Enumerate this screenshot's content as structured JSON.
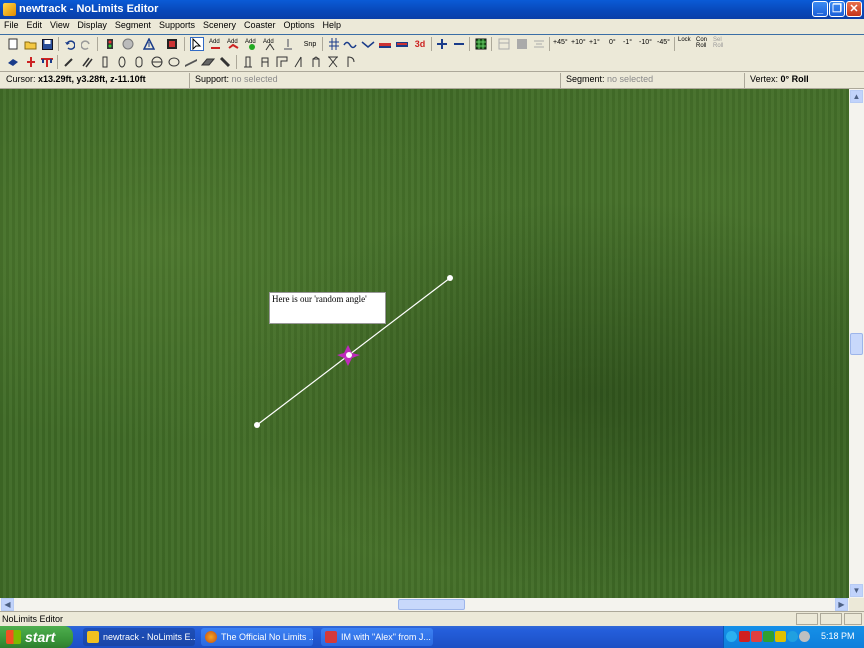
{
  "window": {
    "title": "newtrack - NoLimits Editor"
  },
  "menu": [
    "File",
    "Edit",
    "View",
    "Display",
    "Segment",
    "Supports",
    "Scenery",
    "Coaster",
    "Options",
    "Help"
  ],
  "toolbar1": {
    "add_labels": [
      "Add",
      "Add",
      "Add",
      "Add"
    ],
    "snap_label": "Snp",
    "threed_label": "3d",
    "roll_labels": [
      "+45°",
      "+10°",
      "+1°",
      "0°",
      "-1°",
      "-10°",
      "-45°"
    ],
    "lock_label": "Lock",
    "con_roll_label": "Con Roll",
    "sel_roll_label": "Sel Roll"
  },
  "status": {
    "cursor_label": "Cursor:",
    "cursor_value": "x13.29ft, y3.28ft, z-11.10ft",
    "support_label": "Support:",
    "support_value": "no selected",
    "segment_label": "Segment:",
    "segment_value": "no selected",
    "vertex_label": "Vertex:",
    "vertex_value": "0° Roll"
  },
  "annotation": {
    "text": "Here is our 'random angle'"
  },
  "statusbar": {
    "text": "NoLimits Editor"
  },
  "taskbar": {
    "start_label": "start",
    "tasks": [
      {
        "label": "newtrack - NoLimits E..."
      },
      {
        "label": "The Official No Limits ..."
      },
      {
        "label": "IM with \"Alex\" from J..."
      }
    ],
    "clock": "5:18 PM"
  },
  "colors": {
    "grass": "#3f6a26",
    "track_line": "#ffffff",
    "selected_vertex": "#cc22cc"
  }
}
